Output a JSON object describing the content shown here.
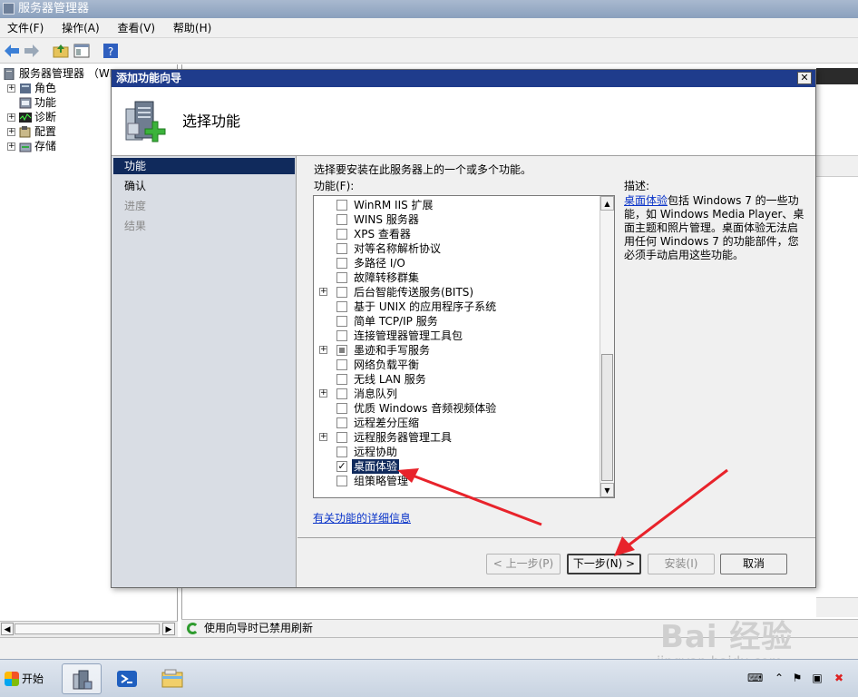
{
  "main_window": {
    "title": "服务器管理器",
    "menu": [
      "文件(F)",
      "操作(A)",
      "查看(V)",
      "帮助(H)"
    ]
  },
  "tree": {
    "root_label": "服务器管理器 （WI",
    "items": [
      {
        "label": "角色",
        "icon": "roles-icon"
      },
      {
        "label": "功能",
        "icon": "features-icon"
      },
      {
        "label": "诊断",
        "icon": "diagnostics-icon"
      },
      {
        "label": "配置",
        "icon": "configuration-icon"
      },
      {
        "label": "存储",
        "icon": "storage-icon"
      }
    ]
  },
  "status_message": "使用向导时已禁用刷新",
  "wizard": {
    "title": "添加功能向导",
    "close_glyph": "✕",
    "header_title": "选择功能",
    "nav": [
      {
        "label": "功能",
        "state": "current"
      },
      {
        "label": "确认",
        "state": "normal"
      },
      {
        "label": "进度",
        "state": "disabled"
      },
      {
        "label": "结果",
        "state": "disabled"
      }
    ],
    "instruction": "选择要安装在此服务器上的一个或多个功能。",
    "features_label": "功能(F):",
    "features": [
      {
        "label": "WinRM IIS 扩展",
        "expandable": false,
        "check": "unchecked"
      },
      {
        "label": "WINS 服务器",
        "expandable": false,
        "check": "unchecked"
      },
      {
        "label": "XPS 查看器",
        "expandable": false,
        "check": "unchecked"
      },
      {
        "label": "对等名称解析协议",
        "expandable": false,
        "check": "unchecked"
      },
      {
        "label": "多路径 I/O",
        "expandable": false,
        "check": "unchecked"
      },
      {
        "label": "故障转移群集",
        "expandable": false,
        "check": "unchecked"
      },
      {
        "label": "后台智能传送服务(BITS)",
        "expandable": true,
        "check": "unchecked"
      },
      {
        "label": "基于 UNIX 的应用程序子系统",
        "expandable": false,
        "check": "unchecked"
      },
      {
        "label": "简单 TCP/IP 服务",
        "expandable": false,
        "check": "unchecked"
      },
      {
        "label": "连接管理器管理工具包",
        "expandable": false,
        "check": "unchecked"
      },
      {
        "label": "墨迹和手写服务",
        "expandable": true,
        "check": "partial"
      },
      {
        "label": "网络负载平衡",
        "expandable": false,
        "check": "unchecked"
      },
      {
        "label": "无线 LAN 服务",
        "expandable": false,
        "check": "unchecked"
      },
      {
        "label": "消息队列",
        "expandable": true,
        "check": "unchecked"
      },
      {
        "label": "优质 Windows 音频视频体验",
        "expandable": false,
        "check": "unchecked"
      },
      {
        "label": "远程差分压缩",
        "expandable": false,
        "check": "unchecked"
      },
      {
        "label": "远程服务器管理工具",
        "expandable": true,
        "check": "unchecked"
      },
      {
        "label": "远程协助",
        "expandable": false,
        "check": "unchecked"
      },
      {
        "label": "桌面体验",
        "expandable": false,
        "check": "checked",
        "selected": true
      },
      {
        "label": "组策略管理",
        "expandable": false,
        "check": "unchecked"
      }
    ],
    "more_info_link": "有关功能的详细信息",
    "description_label": "描述:",
    "description_link": "桌面体验",
    "description_text": "包括 Windows 7 的一些功能，如 Windows Media Player、桌面主题和照片管理。桌面体验无法启用任何 Windows 7 的功能部件，您必须手动启用这些功能。",
    "buttons": {
      "back": "< 上一步(P)",
      "next": "下一步(N) >",
      "install": "安装(I)",
      "cancel": "取消"
    }
  },
  "taskbar": {
    "start_label": "开始",
    "apps": [
      "server-manager-icon",
      "powershell-icon",
      "explorer-icon"
    ]
  },
  "watermark": {
    "logo": "Bai 经验",
    "url": "jingyan.baidu.com"
  },
  "colors": {
    "selection": "#102a5c",
    "title_bar": "#1f3c8c",
    "link": "#0a34c9",
    "annotation_arrow": "#e8232b"
  }
}
